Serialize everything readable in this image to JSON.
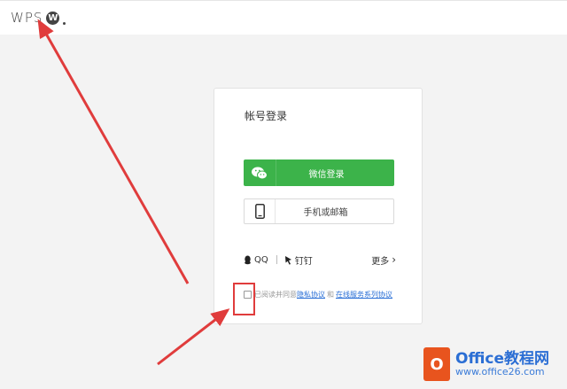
{
  "header": {
    "logo_text": "WPS",
    "logo_badge": "W"
  },
  "login": {
    "title": "帐号登录",
    "wechat_label": "微信登录",
    "phone_label": "手机或邮箱",
    "qq_label": "QQ",
    "dingtalk_label": "钉钉",
    "more_label": "更多",
    "more_chevron": "›",
    "agree_prefix": "已阅读并同意",
    "privacy_link": "隐私协议",
    "and_text": "和",
    "service_link": "在线服务系列协议"
  },
  "watermark": {
    "title_prefix": "Office",
    "title_cn": "教程网",
    "url": "www.office26.com"
  },
  "colors": {
    "wechat_green": "#3cb34a",
    "annotation_red": "#e03c3c",
    "link_blue": "#2a6fd6"
  },
  "icons": [
    "wps-logo",
    "wechat-icon",
    "phone-icon",
    "qq-icon",
    "dingtalk-icon",
    "chevron-right-icon",
    "checkbox"
  ]
}
